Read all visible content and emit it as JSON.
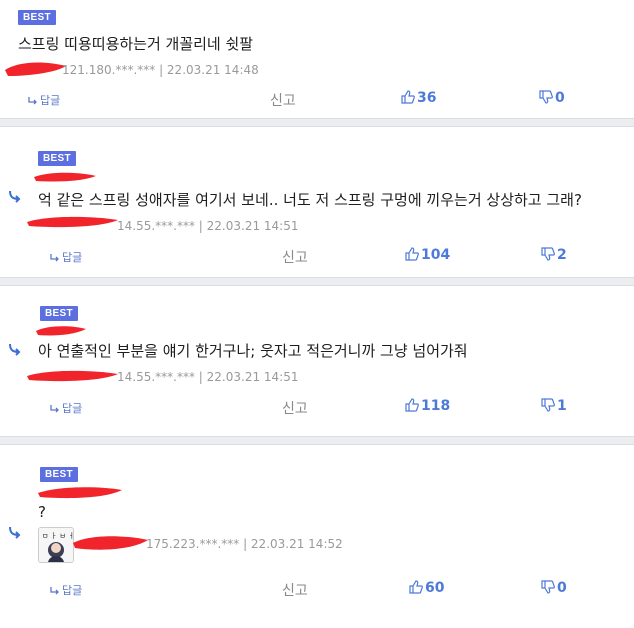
{
  "comments": [
    {
      "badge": "BEST",
      "text": "스프링 띠용띠용하는거 개꼴리네 쉿팔",
      "meta": "121.180.***.*** | 22.03.21 14:48",
      "reply_label": "답글",
      "report_label": "신고",
      "likes": "36",
      "dislikes": "0"
    },
    {
      "badge": "BEST",
      "text": "억 같은 스프링 성애자를 여기서 보네.. 너도 저 스프링 구멍에 끼우는거 상상하고 그래?",
      "meta": "14.55.***.*** | 22.03.21 14:51",
      "reply_label": "답글",
      "report_label": "신고",
      "likes": "104",
      "dislikes": "2"
    },
    {
      "badge": "BEST",
      "text": "아 연출적인 부분을 얘기 한거구나; 웃자고 적은거니까 그냥 넘어가줘",
      "meta": "14.55.***.*** | 22.03.21 14:51",
      "reply_label": "답글",
      "report_label": "신고",
      "likes": "118",
      "dislikes": "1"
    },
    {
      "badge": "BEST",
      "text": "?",
      "meta": "175.223.***.*** | 22.03.21 14:52",
      "reply_label": "답글",
      "report_label": "신고",
      "likes": "60",
      "dislikes": "0"
    }
  ],
  "icons": {
    "reply": "reply-arrow-icon",
    "like": "thumbs-up-icon",
    "dislike": "thumbs-down-icon",
    "nested": "nested-reply-icon"
  },
  "colors": {
    "badge": "#5b6fe0",
    "accent": "#4d79d8",
    "redaction": "#f0242a"
  }
}
